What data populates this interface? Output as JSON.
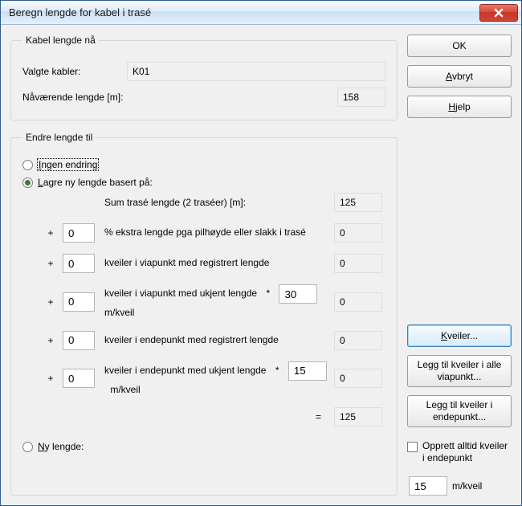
{
  "window": {
    "title": "Beregn lengde for kabel i trasé"
  },
  "buttons": {
    "ok": "OK",
    "cancel_prefix": "",
    "cancel_u": "A",
    "cancel_rest": "vbryt",
    "help_prefix": "",
    "help_u": "H",
    "help_rest": "jelp",
    "kveiler_u": "K",
    "kveiler_rest": "veiler...",
    "add_all_via": "Legg til kveiler i alle viapunkt...",
    "add_endpoint": "Legg til kveiler i endepunkt..."
  },
  "group_now": {
    "legend": "Kabel lengde nå",
    "selected_label": "Valgte kabler:",
    "selected_value": "K01",
    "current_len_label": "Nåværende lengde [m]:",
    "current_len_value": "158"
  },
  "group_change": {
    "legend": "Endre lengde til",
    "radio_none_u": "I",
    "radio_none_rest": "ngen endring",
    "radio_save_u": "L",
    "radio_save_rest": "agre ny lengde basert på:",
    "radio_new_u": "N",
    "radio_new_rest": "y lengde:"
  },
  "calc": {
    "sum_label": "Sum trasé lengde (2 traséer) [m]:",
    "sum_value": "125",
    "ext_pct_in": "0",
    "ext_pct_label": "% ekstra lengde pga pilhøyde eller slakk i trasé",
    "ext_pct_out": "0",
    "via_reg_in": "0",
    "via_reg_label": "kveiler i viapunkt med registrert lengde",
    "via_reg_out": "0",
    "via_unk_in": "0",
    "via_unk_label_a": "kveiler i viapunkt med ukjent lengde",
    "via_unk_mul_label": "*",
    "via_unk_mul_in": "30",
    "via_unk_unit": "m/kveil",
    "via_unk_out": "0",
    "end_reg_in": "0",
    "end_reg_label": "kveiler i endepunkt med registrert lengde",
    "end_reg_out": "0",
    "end_unk_in": "0",
    "end_unk_label_a": "kveiler i endepunkt med ukjent lengde",
    "end_unk_mul_in": "15",
    "end_unk_unit": "m/kveil",
    "end_unk_out": "0",
    "eq_sign": "=",
    "total": "125",
    "plus": "+"
  },
  "right": {
    "always_coil_label": "Opprett alltid kveiler i endepunkt",
    "mkveil_value": "15",
    "mkveil_unit": "m/kveil"
  }
}
